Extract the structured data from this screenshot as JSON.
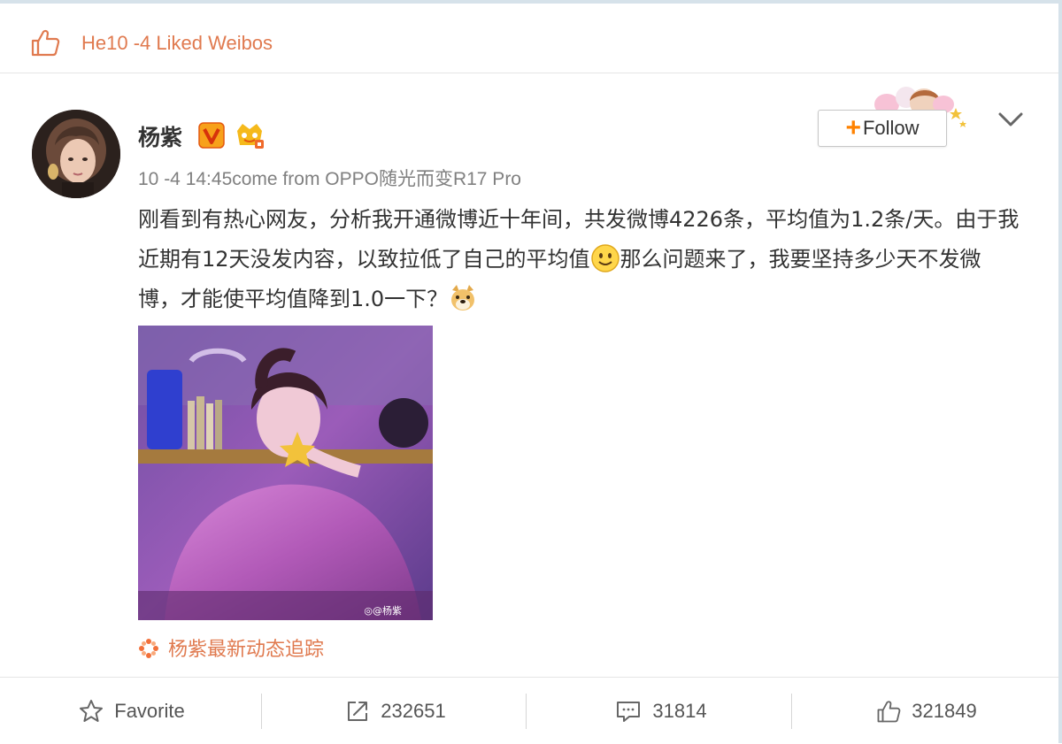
{
  "liked_header": {
    "icon": "thumbs-up-icon",
    "text": "He10 -4 Liked Weibos"
  },
  "post": {
    "username": "杨紫",
    "badges": [
      "verified-v-icon",
      "vip-crown-icon"
    ],
    "meta": "10 -4 14:45come from OPPO随光而变R17 Pro",
    "content": {
      "part1": "刚看到有热心网友，分析我开通微博近十年间，共发微博4226条，平均值为1.2条/天。由于我近期有12天没发内容，以致拉低了自己的平均值",
      "emoji1": "smile-emoji-icon",
      "part2": "那么问题来了，我要坚持多少天不发微博，才能使平均值降到1.0一下？",
      "emoji2": "doge-emoji-icon"
    },
    "image_watermark": "◎@杨紫",
    "tracking_label": "杨紫最新动态追踪"
  },
  "follow_button": {
    "plus": "+",
    "label": "Follow"
  },
  "actions": {
    "favorite_label": "Favorite",
    "repost_count": "232651",
    "comment_count": "31814",
    "like_count": "321849"
  },
  "colors": {
    "accent": "#e07a4f",
    "follow_plus": "#ff8200"
  }
}
